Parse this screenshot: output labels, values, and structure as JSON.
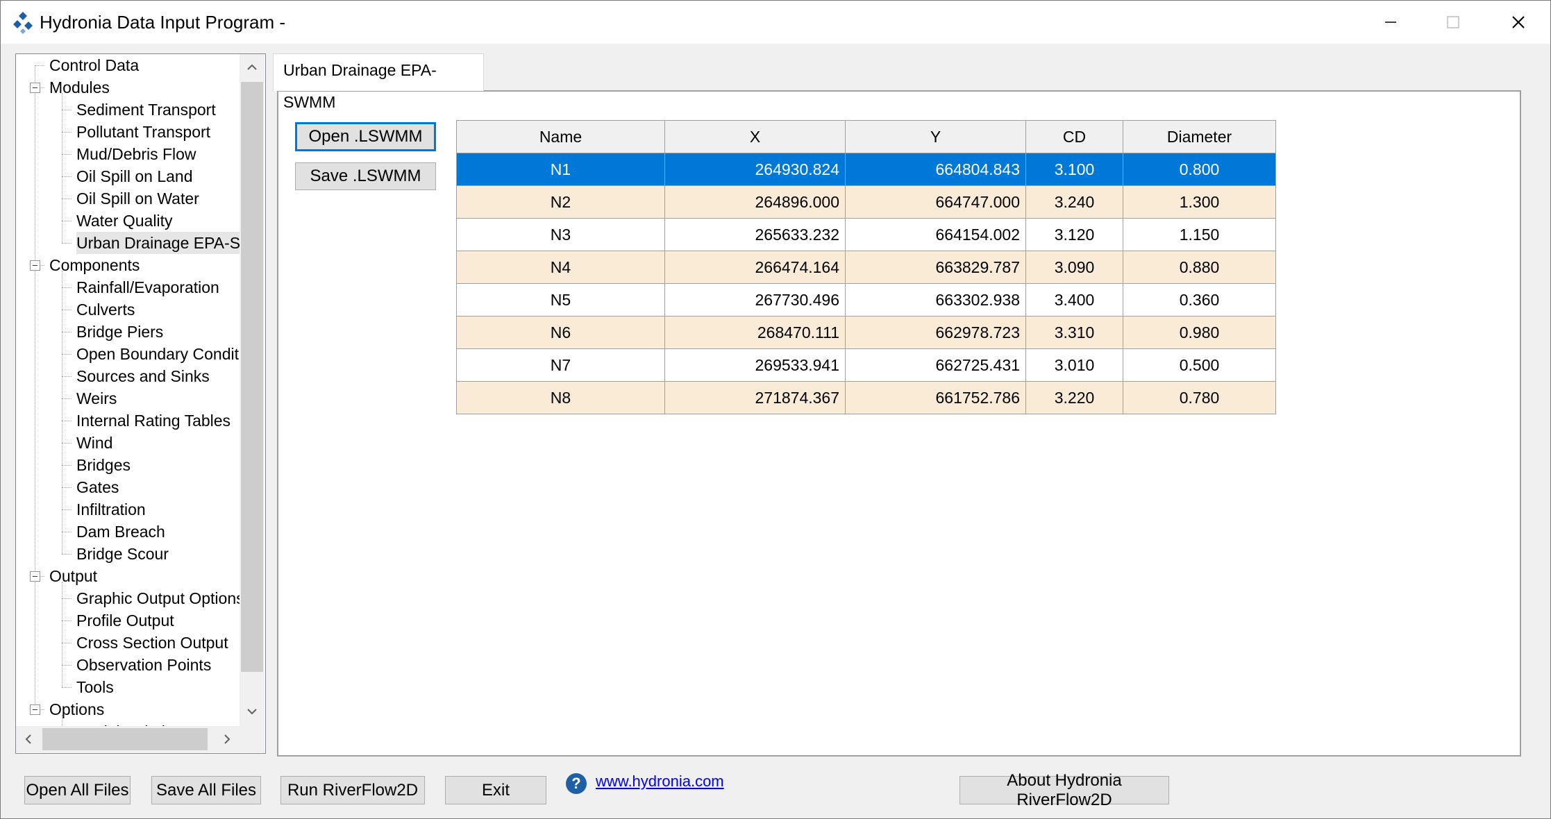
{
  "window": {
    "title": "Hydronia Data Input Program -",
    "minimize_label": "─",
    "maximize_label": "☐",
    "close_label": "✕",
    "app_icon": "hydronia-logo-icon"
  },
  "tree": {
    "items": [
      {
        "label": "Control Data",
        "level": 0,
        "expander": false
      },
      {
        "label": "Modules",
        "level": 0,
        "expander": true
      },
      {
        "label": "Sediment Transport",
        "level": 1
      },
      {
        "label": "Pollutant Transport",
        "level": 1
      },
      {
        "label": "Mud/Debris Flow",
        "level": 1
      },
      {
        "label": "Oil Spill on Land",
        "level": 1
      },
      {
        "label": "Oil Spill on Water",
        "level": 1
      },
      {
        "label": "Water Quality",
        "level": 1
      },
      {
        "label": "Urban Drainage EPA-SWMM",
        "level": 1,
        "selected": true
      },
      {
        "label": "Components",
        "level": 0,
        "expander": true
      },
      {
        "label": "Rainfall/Evaporation",
        "level": 1
      },
      {
        "label": "Culverts",
        "level": 1
      },
      {
        "label": "Bridge Piers",
        "level": 1
      },
      {
        "label": "Open Boundary Conditions",
        "level": 1
      },
      {
        "label": "Sources and Sinks",
        "level": 1
      },
      {
        "label": "Weirs",
        "level": 1
      },
      {
        "label": "Internal Rating Tables",
        "level": 1
      },
      {
        "label": "Wind",
        "level": 1
      },
      {
        "label": "Bridges",
        "level": 1
      },
      {
        "label": "Gates",
        "level": 1
      },
      {
        "label": "Infiltration",
        "level": 1
      },
      {
        "label": "Dam Breach",
        "level": 1
      },
      {
        "label": "Bridge Scour",
        "level": 1
      },
      {
        "label": "Output",
        "level": 0,
        "expander": true
      },
      {
        "label": "Graphic Output Options",
        "level": 1
      },
      {
        "label": "Profile Output",
        "level": 1
      },
      {
        "label": "Cross Section Output",
        "level": 1
      },
      {
        "label": "Observation Points",
        "level": 1
      },
      {
        "label": "Tools",
        "level": 1
      },
      {
        "label": "Options",
        "level": 0,
        "expander": true
      },
      {
        "label": "Model Relations",
        "level": 1
      }
    ]
  },
  "tab": {
    "label": "Urban Drainage EPA-SWMM"
  },
  "buttons": {
    "open_lswmm": "Open .LSWMM",
    "save_lswmm": "Save .LSWMM",
    "open_all": "Open All Files",
    "save_all": "Save All Files",
    "run": "Run RiverFlow2D",
    "exit": "Exit",
    "about": "About Hydronia RiverFlow2D"
  },
  "grid": {
    "columns": [
      "Name",
      "X",
      "Y",
      "CD",
      "Diameter"
    ],
    "rows": [
      [
        "N1",
        "264930.824",
        "664804.843",
        "3.100",
        "0.800"
      ],
      [
        "N2",
        "264896.000",
        "664747.000",
        "3.240",
        "1.300"
      ],
      [
        "N3",
        "265633.232",
        "664154.002",
        "3.120",
        "1.150"
      ],
      [
        "N4",
        "266474.164",
        "663829.787",
        "3.090",
        "0.880"
      ],
      [
        "N5",
        "267730.496",
        "663302.938",
        "3.400",
        "0.360"
      ],
      [
        "N6",
        "268470.111",
        "662978.723",
        "3.310",
        "0.980"
      ],
      [
        "N7",
        "269533.941",
        "662725.431",
        "3.010",
        "0.500"
      ],
      [
        "N8",
        "271874.367",
        "661752.786",
        "3.220",
        "0.780"
      ]
    ],
    "selected_row": 0
  },
  "footer": {
    "help_icon": "question-circle-icon",
    "help_symbol": "?",
    "link": "www.hydronia.com"
  },
  "colors": {
    "selection": "#0078d7",
    "alt_row": "#faebd7",
    "link": "#0000ff"
  }
}
